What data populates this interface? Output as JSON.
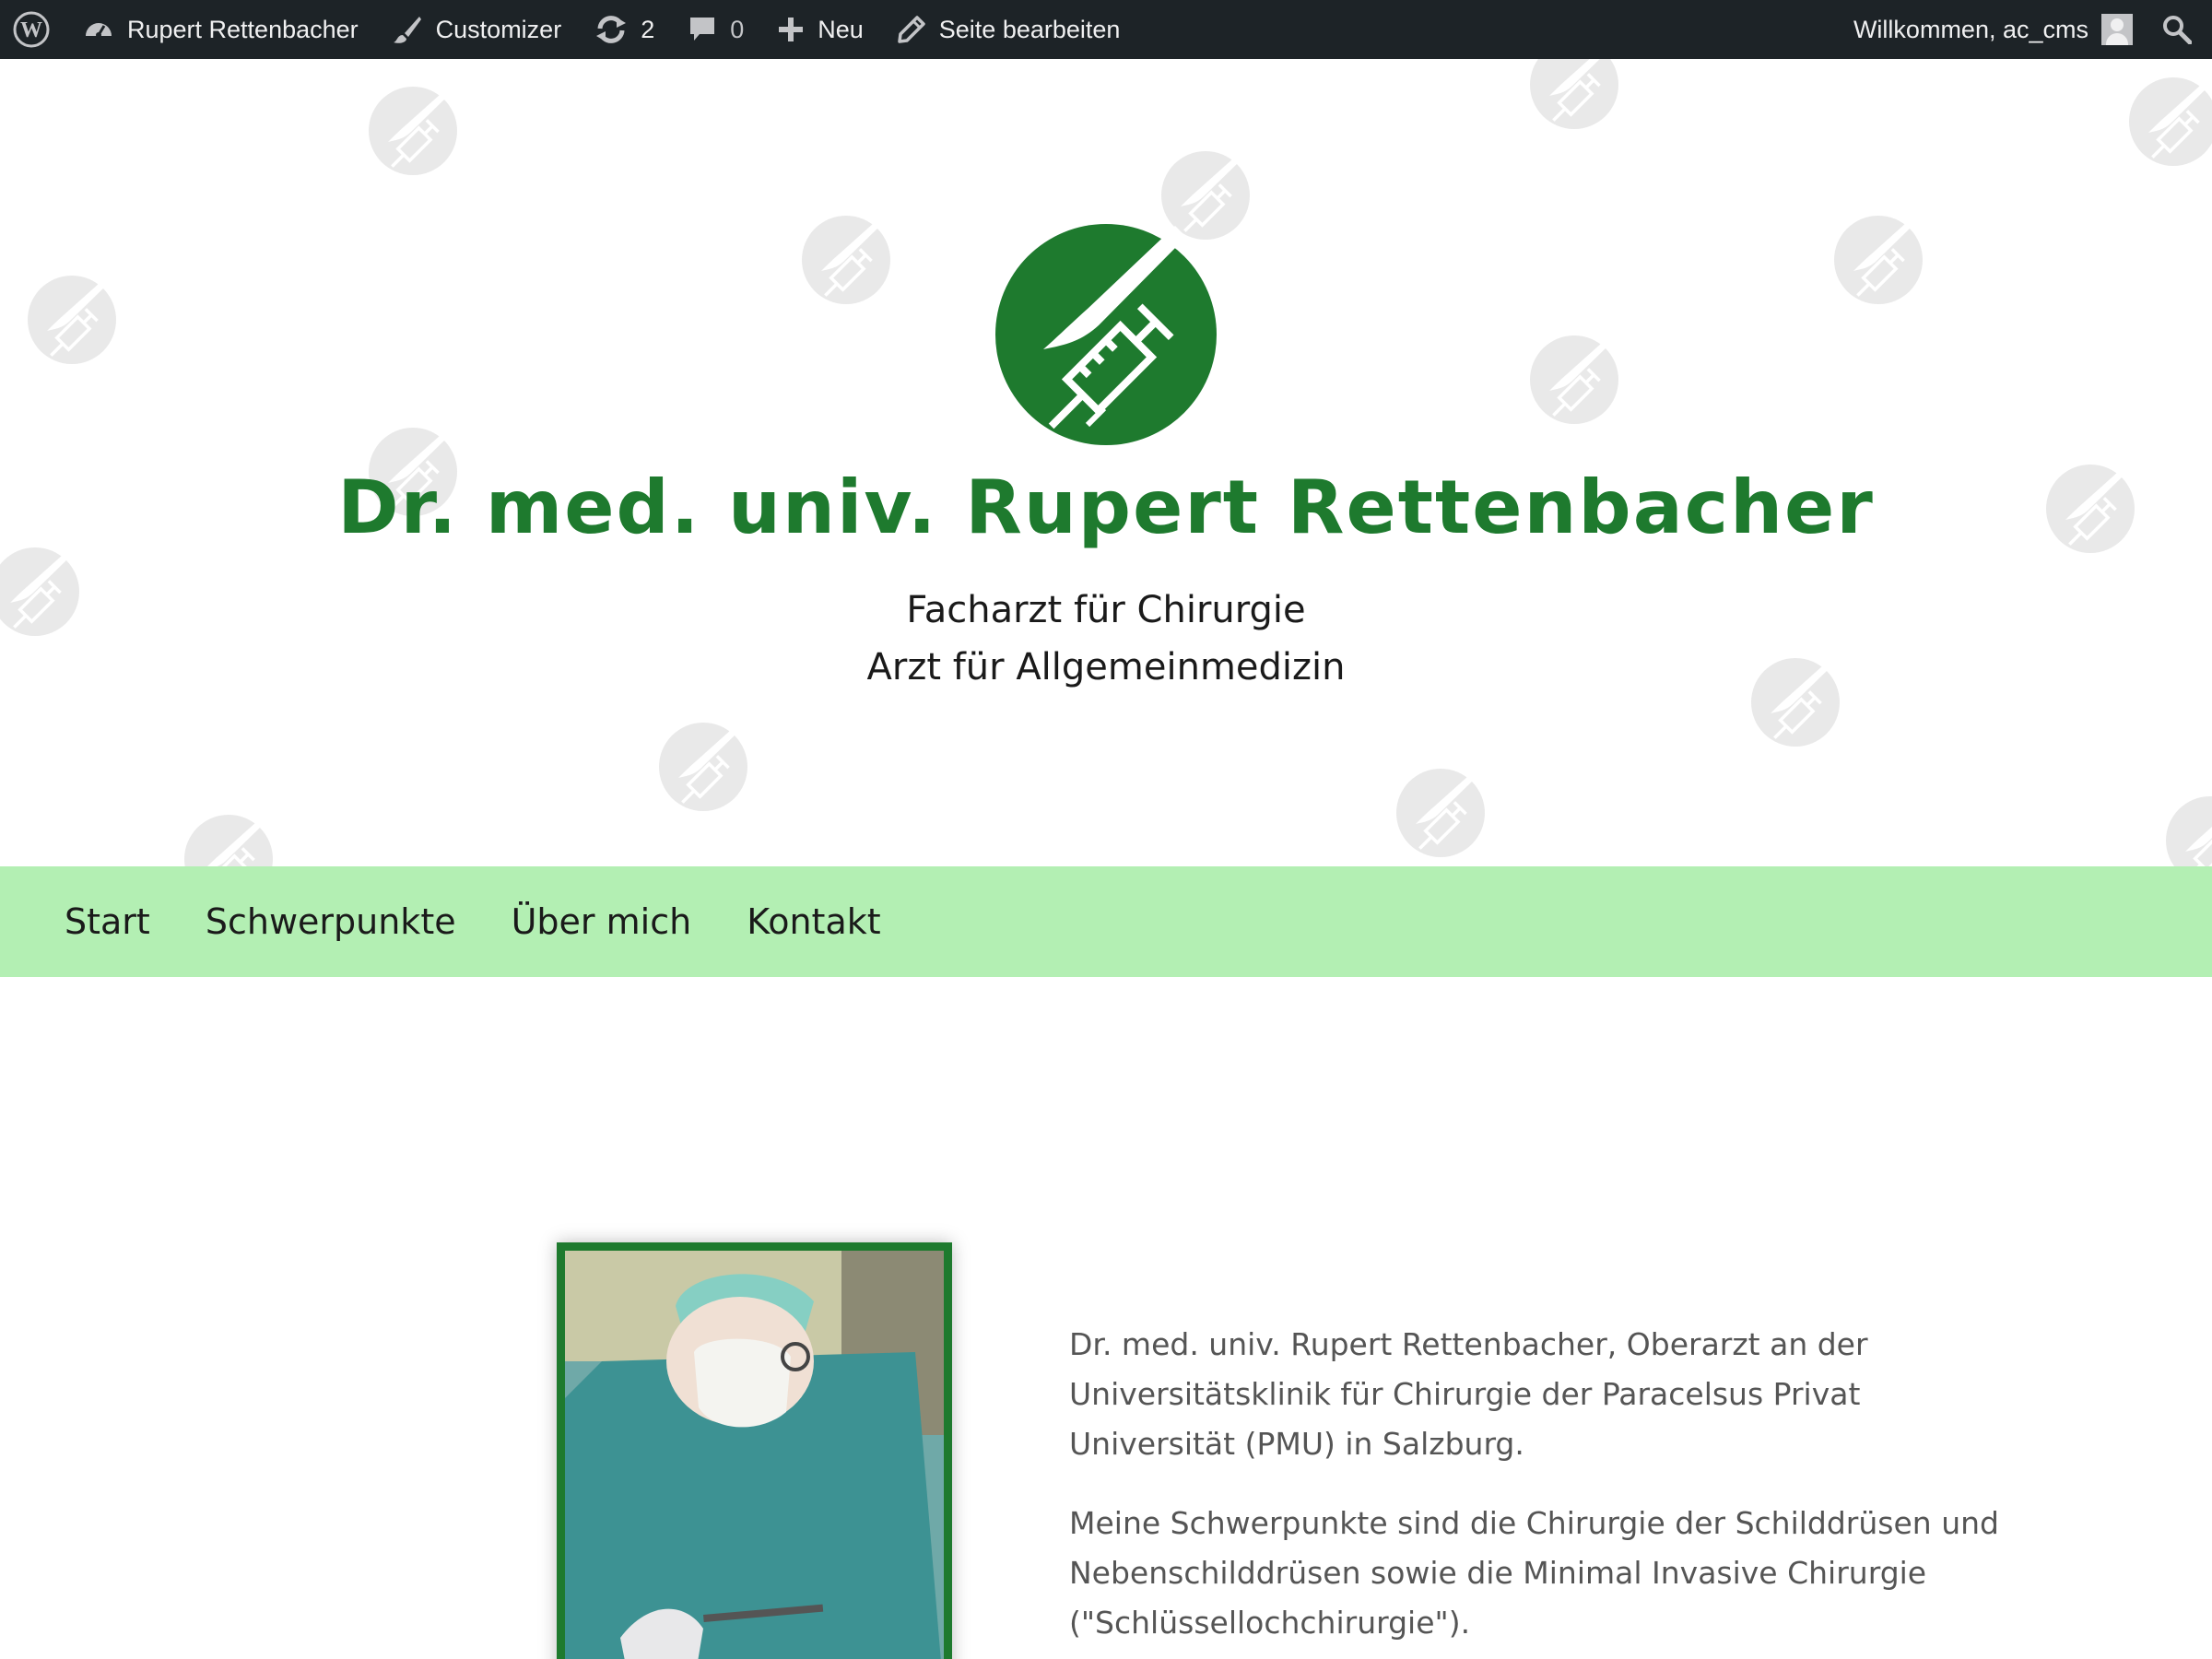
{
  "admin_bar": {
    "site_name": "Rupert Rettenbacher",
    "customizer_label": "Customizer",
    "updates_count": "2",
    "comments_count": "0",
    "new_label": "Neu",
    "edit_label": "Seite bearbeiten",
    "welcome_text": "Willkommen, ac_cms"
  },
  "header": {
    "title": "Dr. med. univ. Rupert Rettenbacher",
    "tagline_line1": "Facharzt für Chirurgie",
    "tagline_line2": "Arzt für Allgemeinmedizin",
    "brand_color": "#1e7a2e"
  },
  "nav": {
    "items": [
      {
        "label": "Start"
      },
      {
        "label": "Schwerpunkte"
      },
      {
        "label": "Über mich"
      },
      {
        "label": "Kontakt"
      }
    ],
    "background": "#b3efb3"
  },
  "content": {
    "paragraph1": "Dr. med. univ. Rupert Rettenbacher, Oberarzt an der Universi­tätsklinik für Chirurgie der Paracelsus Privat Universität (PMU) in Salzburg.",
    "paragraph2": "Meine Schwerpunkte sind die Chirurgie der Schilddrüsen und Nebenschilddrüsen sowie die Minimal Invasive Chirurgie (\"Schlüssellochchirurgie\")."
  },
  "icons": {
    "wordpress": "wordpress-logo-icon",
    "dashboard": "dashboard-icon",
    "brush": "brush-icon",
    "updates": "refresh-icon",
    "comments": "comment-icon",
    "new": "plus-icon",
    "edit": "pencil-icon",
    "search": "search-icon",
    "site_logo": "scalpel-syringe-logo-icon"
  }
}
